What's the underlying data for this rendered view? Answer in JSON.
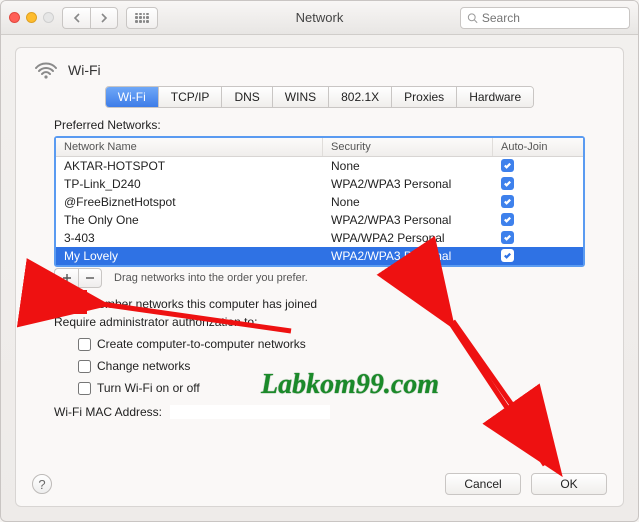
{
  "window": {
    "title": "Network"
  },
  "search": {
    "placeholder": "Search"
  },
  "header": {
    "interface_label": "Wi-Fi"
  },
  "tabs": {
    "items": [
      {
        "label": "Wi-Fi",
        "active": true
      },
      {
        "label": "TCP/IP"
      },
      {
        "label": "DNS"
      },
      {
        "label": "WINS"
      },
      {
        "label": "802.1X"
      },
      {
        "label": "Proxies"
      },
      {
        "label": "Hardware"
      }
    ]
  },
  "preferred_networks": {
    "label": "Preferred Networks:",
    "columns": {
      "name": "Network Name",
      "security": "Security",
      "autojoin": "Auto-Join"
    },
    "rows": [
      {
        "name": "AKTAR-HOTSPOT",
        "security": "None",
        "autojoin": true
      },
      {
        "name": "TP-Link_D240",
        "security": "WPA2/WPA3 Personal",
        "autojoin": true
      },
      {
        "name": "@FreeBiznetHotspot",
        "security": "None",
        "autojoin": true
      },
      {
        "name": "The Only One",
        "security": "WPA2/WPA3 Personal",
        "autojoin": true
      },
      {
        "name": "3-403",
        "security": "WPA/WPA2 Personal",
        "autojoin": true
      },
      {
        "name": "My Lovely",
        "security": "WPA2/WPA3 Personal",
        "autojoin": true,
        "selected": true
      }
    ],
    "hint": "Drag networks into the order you prefer."
  },
  "options": {
    "remember": {
      "label": "Remember networks this computer has joined",
      "checked": true
    },
    "admin_label": "Require administrator authorization to:",
    "admin": [
      {
        "label": "Create computer-to-computer networks",
        "checked": false
      },
      {
        "label": "Change networks",
        "checked": false
      },
      {
        "label": "Turn Wi-Fi on or off",
        "checked": false
      }
    ],
    "mac_label": "Wi-Fi MAC Address:",
    "mac_value": ""
  },
  "footer": {
    "cancel": "Cancel",
    "ok": "OK"
  },
  "watermark": "Labkom99.com"
}
